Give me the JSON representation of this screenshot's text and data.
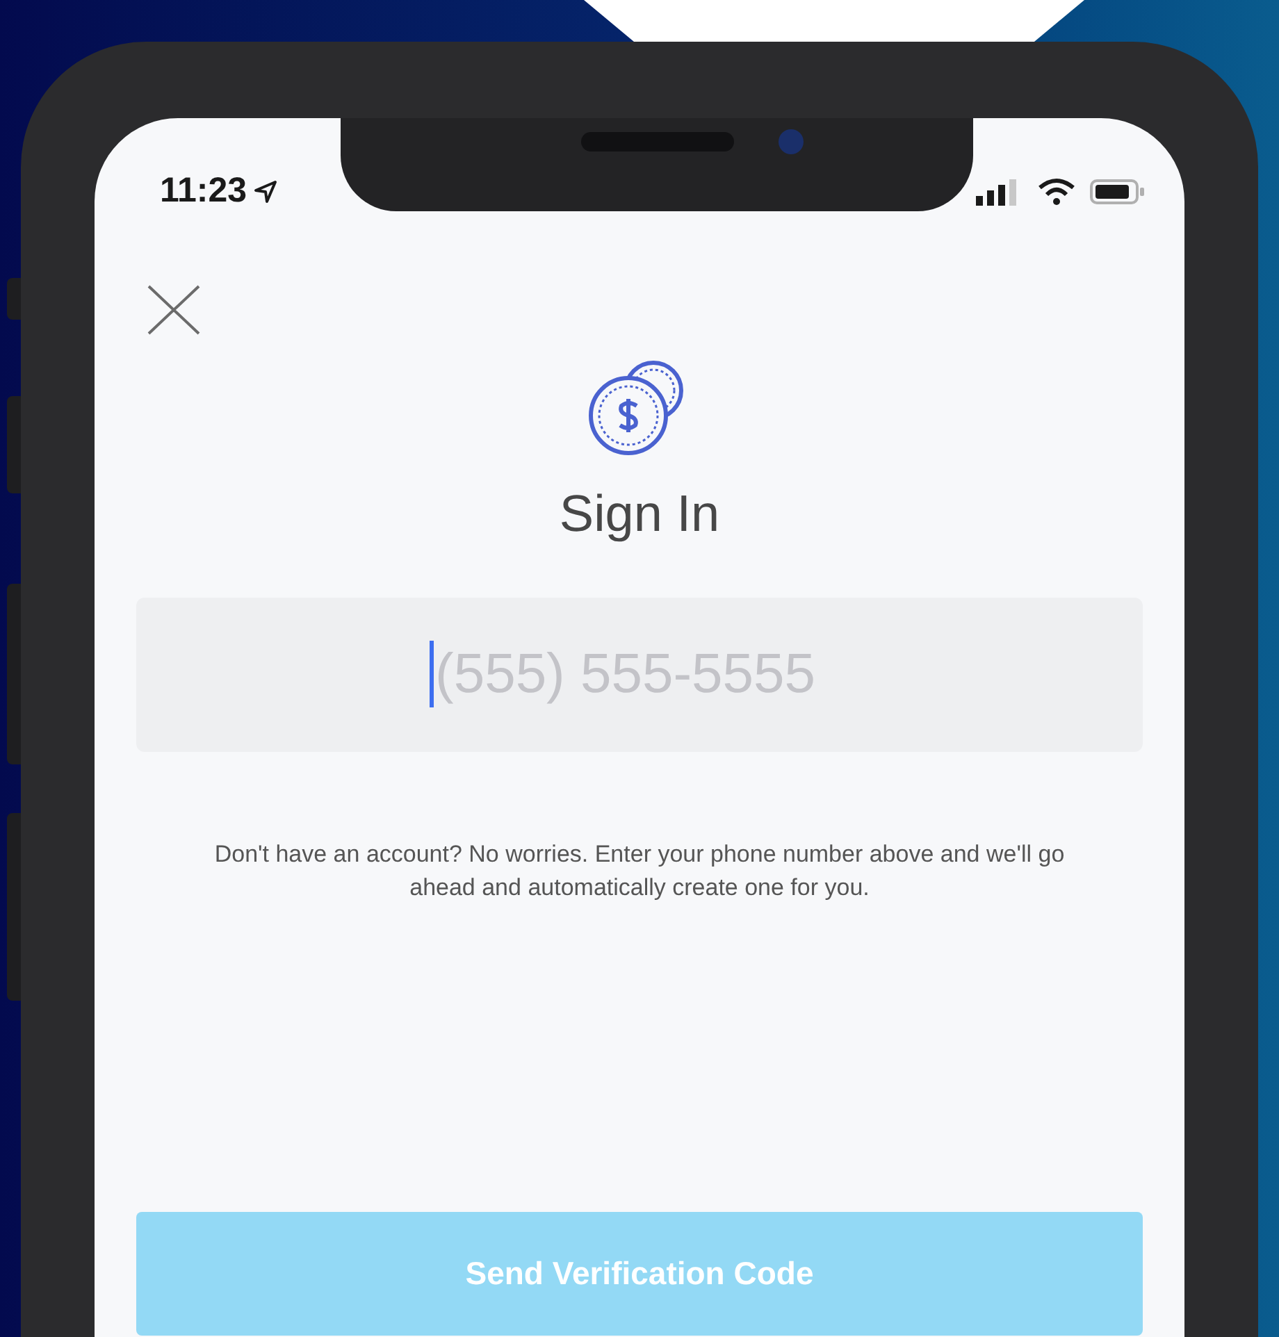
{
  "status_bar": {
    "time": "11:23"
  },
  "title": "Sign In",
  "phone_field": {
    "placeholder": "(555) 555-5555",
    "focused": true
  },
  "info_text": "Don't have an account? No worries. Enter your phone number above and we'll go ahead and automatically create one for you.",
  "submit_button": {
    "label": "Send Verification Code",
    "disabled": true
  }
}
